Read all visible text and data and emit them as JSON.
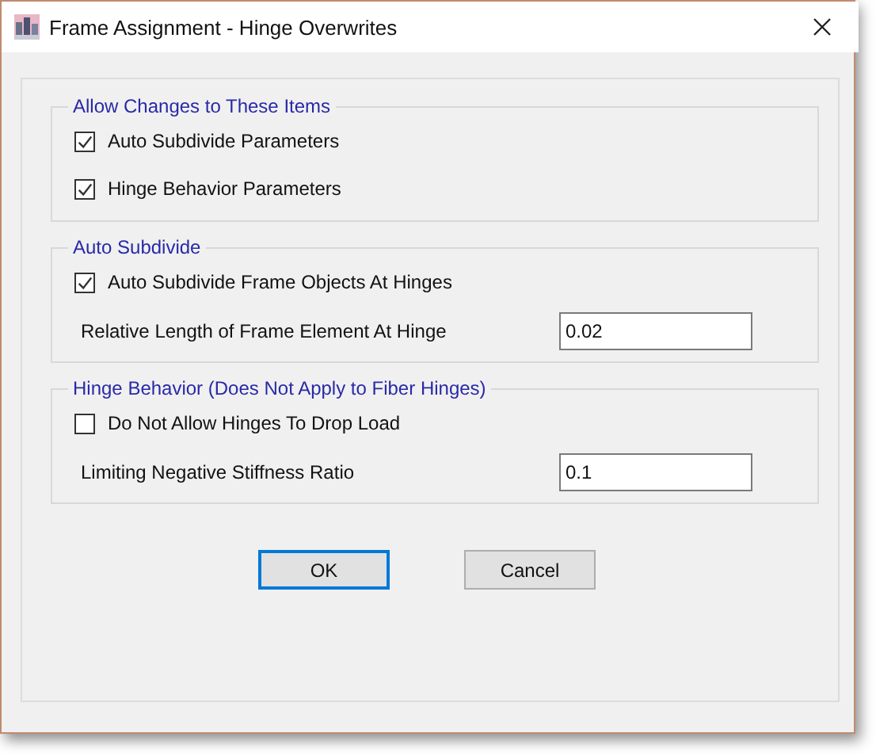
{
  "window": {
    "title": "Frame Assignment - Hinge Overwrites"
  },
  "groups": [
    {
      "legend": "Allow Changes to These Items",
      "items": [
        {
          "kind": "checkbox",
          "label": "Auto Subdivide Parameters",
          "checked": true
        },
        {
          "kind": "checkbox",
          "label": "Hinge Behavior Parameters",
          "checked": true
        }
      ]
    },
    {
      "legend": "Auto Subdivide",
      "items": [
        {
          "kind": "checkbox",
          "label": "Auto Subdivide Frame Objects At Hinges",
          "checked": true
        },
        {
          "kind": "field",
          "label": "Relative Length of Frame Element At Hinge",
          "value": "0.02"
        }
      ]
    },
    {
      "legend": "Hinge Behavior  (Does Not Apply to Fiber Hinges)",
      "items": [
        {
          "kind": "checkbox",
          "label": "Do Not Allow Hinges To Drop Load",
          "checked": false
        },
        {
          "kind": "field",
          "label": "Limiting Negative Stiffness Ratio",
          "value": "0.1"
        }
      ]
    }
  ],
  "buttons": [
    {
      "label": "OK",
      "default": true
    },
    {
      "label": "Cancel",
      "default": false
    }
  ]
}
